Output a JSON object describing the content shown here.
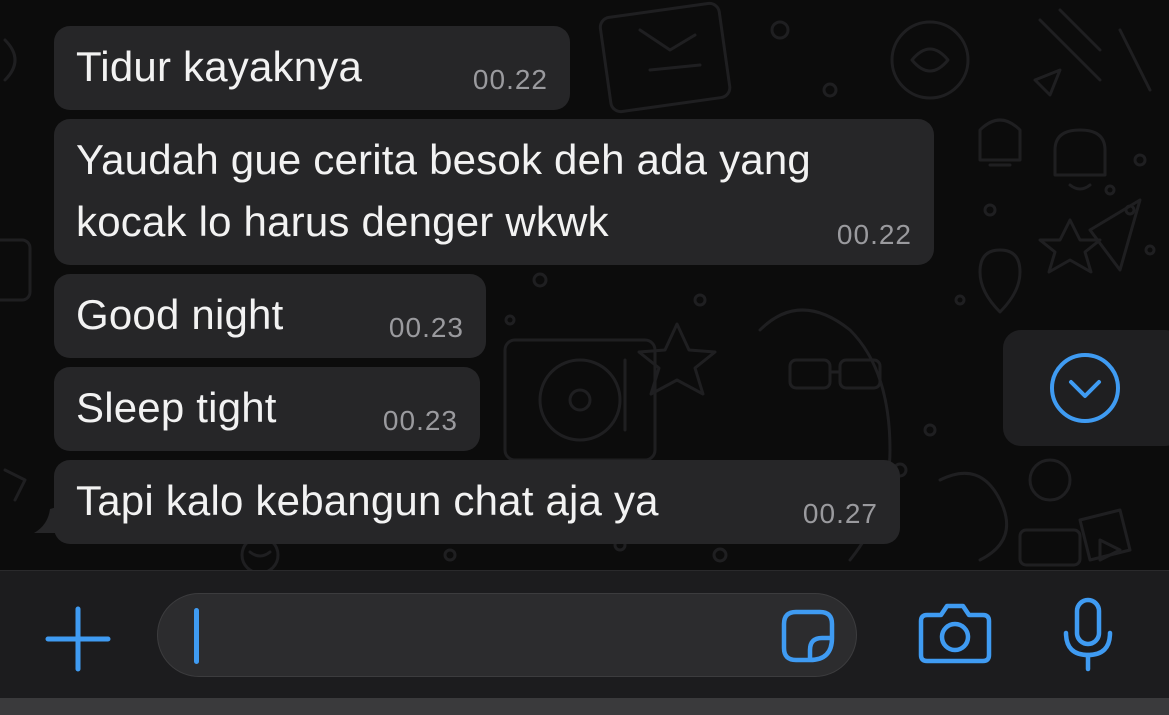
{
  "messages": [
    {
      "text_lines": [
        "Tidur kayaknya"
      ],
      "time": "00.22"
    },
    {
      "text_lines": [
        "Yaudah gue cerita besok deh ada yang",
        "kocak lo harus denger wkwk"
      ],
      "time": "00.22"
    },
    {
      "text_lines": [
        "Good night"
      ],
      "time": "00.23"
    },
    {
      "text_lines": [
        "Sleep tight"
      ],
      "time": "00.23"
    },
    {
      "text_lines": [
        "Tapi kalo kebangun chat aja ya"
      ],
      "time": "00.27"
    }
  ],
  "composer": {
    "input_value": "",
    "icons": [
      "plus-icon",
      "sticker-icon",
      "camera-icon",
      "microphone-icon"
    ]
  },
  "scroll_button": {
    "icon": "chevron-down-circle-icon"
  },
  "colors": {
    "accent": "#3f9bf2",
    "bubble": "#262628",
    "timestamp": "#9a9a9e",
    "background": "#0c0c0c"
  }
}
